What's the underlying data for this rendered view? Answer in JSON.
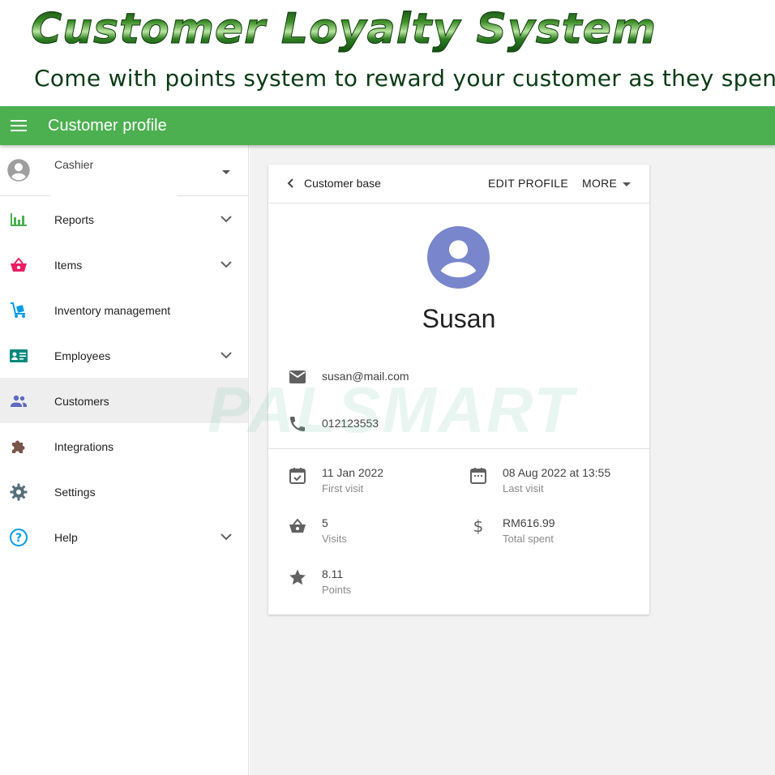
{
  "banner": {
    "title": "Customer Loyalty System",
    "subtitle": "Come with points system to reward your customer as they spend."
  },
  "appbar": {
    "title": "Customer profile",
    "color": "#4caf50"
  },
  "sidebar": {
    "user_label": "Cashier",
    "items": [
      {
        "label": "Reports",
        "icon": "bar-chart-icon",
        "expandable": true,
        "icon_color": "#4caf50"
      },
      {
        "label": "Items",
        "icon": "basket-icon",
        "expandable": true,
        "icon_color": "#e91e63"
      },
      {
        "label": "Inventory management",
        "icon": "hand-truck-icon",
        "expandable": false,
        "icon_color": "#039be5"
      },
      {
        "label": "Employees",
        "icon": "id-card-icon",
        "expandable": true,
        "icon_color": "#00897b"
      },
      {
        "label": "Customers",
        "icon": "people-icon",
        "expandable": false,
        "icon_color": "#5c6bc0",
        "active": true
      },
      {
        "label": "Integrations",
        "icon": "puzzle-icon",
        "expandable": false,
        "icon_color": "#795548"
      },
      {
        "label": "Settings",
        "icon": "gear-icon",
        "expandable": false,
        "icon_color": "#546e7a"
      },
      {
        "label": "Help",
        "icon": "help-circle-icon",
        "expandable": true,
        "icon_color": "#039be5"
      }
    ]
  },
  "card": {
    "back_label": "Customer base",
    "edit_label": "EDIT PROFILE",
    "more_label": "MORE",
    "name": "Susan",
    "avatar_color": "#7986cb",
    "email": "susan@mail.com",
    "phone": "012123553",
    "stats": {
      "first_visit": {
        "value": "11 Jan 2022",
        "label": "First visit"
      },
      "last_visit": {
        "value": "08 Aug 2022 at 13:55",
        "label": "Last visit"
      },
      "visits": {
        "value": "5",
        "label": "Visits"
      },
      "total_spent": {
        "value": "RM616.99",
        "label": "Total spent"
      },
      "points": {
        "value": "8.11",
        "label": "Points"
      }
    }
  },
  "watermark": "PALSMART"
}
